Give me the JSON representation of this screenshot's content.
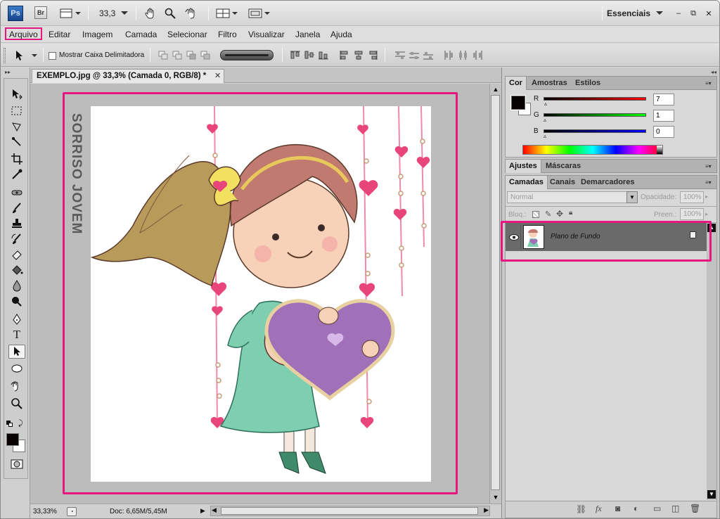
{
  "appbar": {
    "ps_logo": "Ps",
    "br_logo": "Br",
    "zoom_value": "33,3",
    "workspace": "Essenciais",
    "win_minimize": "–",
    "win_restore": "⧉",
    "win_close": "✕"
  },
  "menu": {
    "items": [
      "Arquivo",
      "Editar",
      "Imagem",
      "Camada",
      "Selecionar",
      "Filtro",
      "Visualizar",
      "Janela",
      "Ajuda"
    ]
  },
  "options": {
    "checkbox_label": "Mostrar Caixa Delimitadora",
    "checked": false
  },
  "document": {
    "tab_title": "EXEMPLO.jpg @ 33,3% (Camada 0, RGB/8) *",
    "close": "✕",
    "watermark": "SORRISO JOVEM"
  },
  "status": {
    "zoom": "33,33%",
    "doc_info": "Doc: 6,65M/5,45M"
  },
  "color_panel": {
    "tabs": [
      "Cor",
      "Amostras",
      "Estilos"
    ],
    "channels": [
      {
        "label": "R",
        "value": "7",
        "color": "#e00000"
      },
      {
        "label": "G",
        "value": "1",
        "color": "#00c000"
      },
      {
        "label": "B",
        "value": "0",
        "color": "#0000d0"
      }
    ]
  },
  "adjust_panel": {
    "tabs": [
      "Ajustes",
      "Máscaras"
    ]
  },
  "layers_panel": {
    "tabs": [
      "Camadas",
      "Canais",
      "Demarcadores"
    ],
    "blend_mode": "Normal",
    "opacity_label": "Opacidade:",
    "opacity_value": "100%",
    "lock_label": "Bloq.:",
    "fill_label": "Preen.:",
    "fill_value": "100%",
    "layer_name": "Plano de Fundo"
  },
  "accent": {
    "highlight": "#e8177f"
  }
}
